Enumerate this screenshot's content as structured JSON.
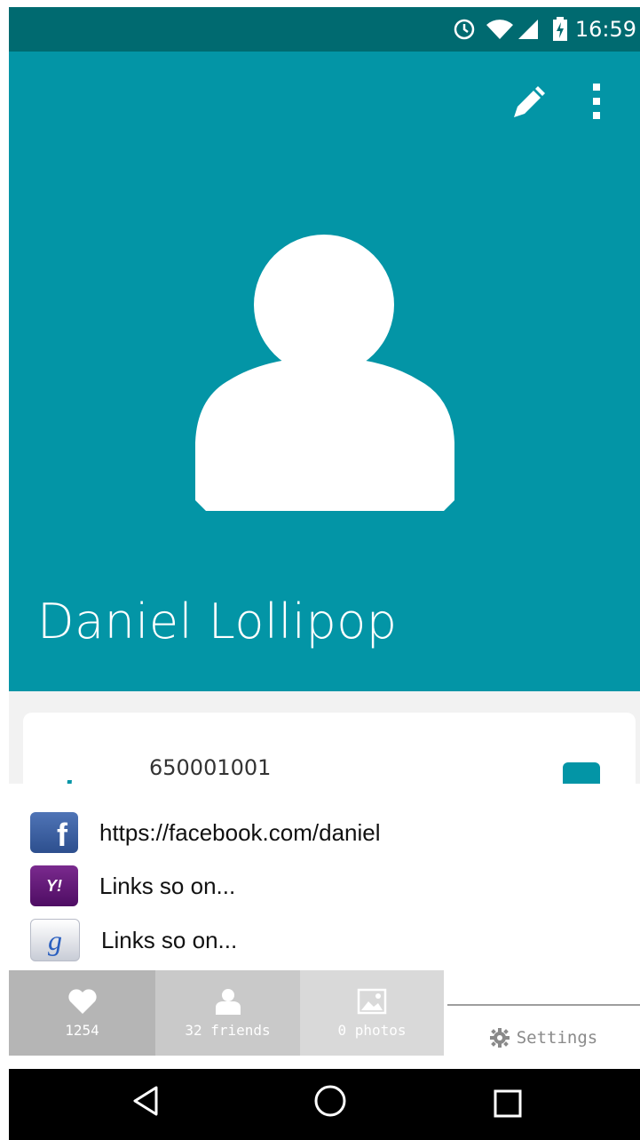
{
  "status_bar": {
    "time": "16:59"
  },
  "profile": {
    "name": "Daniel Lollipop"
  },
  "contact": {
    "phone": "650001001"
  },
  "links": [
    {
      "icon": "facebook-logo-icon",
      "text": "https://facebook.com/daniel"
    },
    {
      "icon": "yahoo-logo-icon",
      "text": "Links so on..."
    },
    {
      "icon": "google-logo-icon",
      "text": "Links so on..."
    }
  ],
  "tabs": {
    "likes": {
      "label": "1254",
      "icon": "heart-icon"
    },
    "friends": {
      "label": "32 friends",
      "icon": "person-icon"
    },
    "photos": {
      "label": "0 photos",
      "icon": "image-icon"
    },
    "settings": {
      "label": "Settings",
      "icon": "gear-icon"
    }
  },
  "colors": {
    "header_teal": "#0395a6",
    "status_bar": "#006a70",
    "tab_likes": "#b5b5b5",
    "tab_friends": "#c9c9c9",
    "tab_photos": "#d9d9d9"
  }
}
